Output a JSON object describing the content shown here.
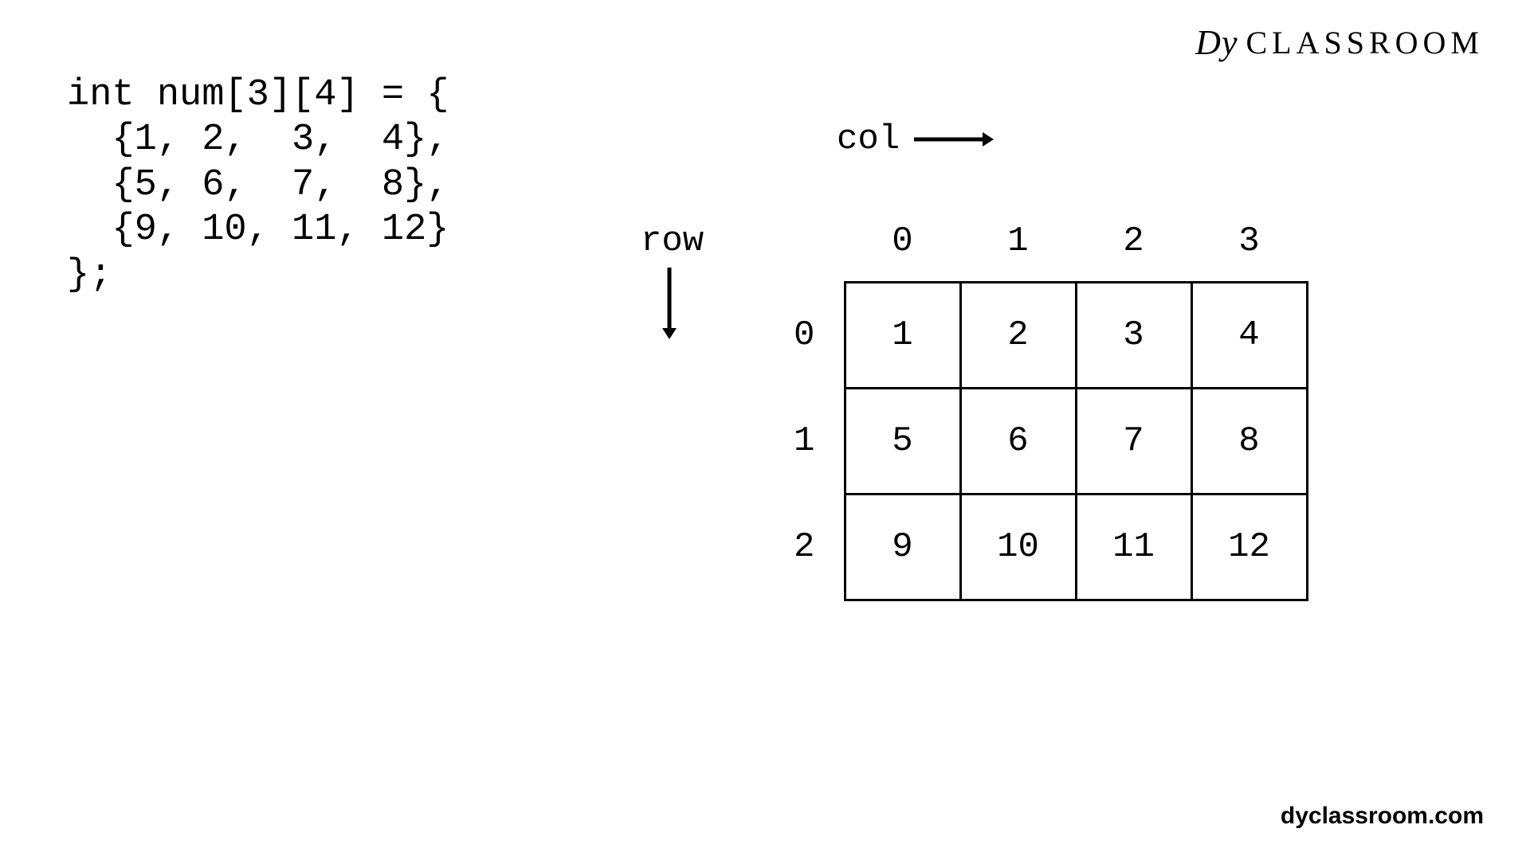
{
  "logo_text": "CLASSROOM",
  "logo_prefix": "Dy",
  "footer": "dyclassroom.com",
  "code": "int num[3][4] = {\n  {1, 2,  3,  4},\n  {5, 6,  7,  8},\n  {9, 10, 11, 12}\n};",
  "labels": {
    "col": "col",
    "row": "row"
  },
  "chart_data": {
    "type": "table",
    "col_headers": [
      "0",
      "1",
      "2",
      "3"
    ],
    "row_headers": [
      "0",
      "1",
      "2"
    ],
    "rows": [
      [
        "1",
        "2",
        "3",
        "4"
      ],
      [
        "5",
        "6",
        "7",
        "8"
      ],
      [
        "9",
        "10",
        "11",
        "12"
      ]
    ]
  }
}
